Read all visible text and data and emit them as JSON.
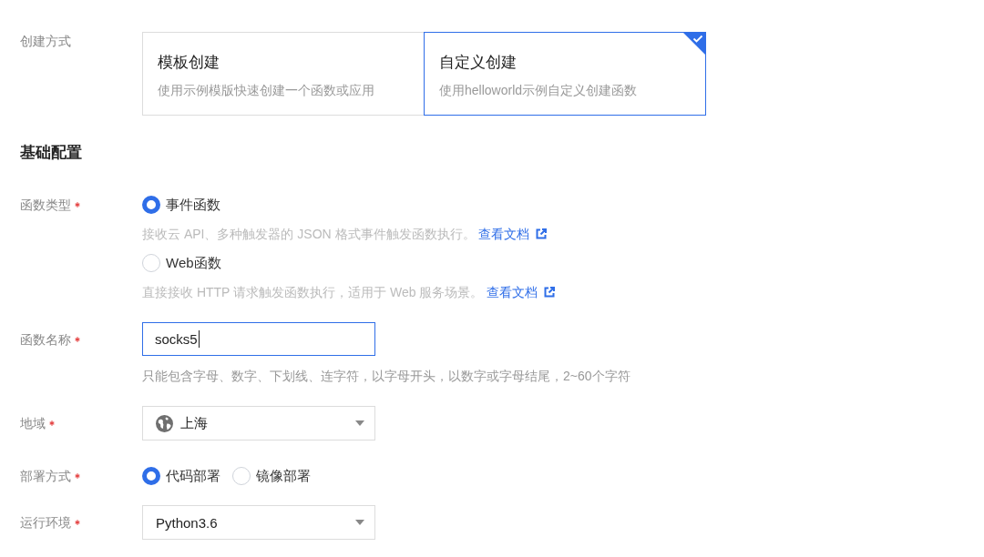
{
  "creation": {
    "label": "创建方式",
    "options": [
      {
        "title": "模板创建",
        "description": "使用示例模版快速创建一个函数或应用",
        "selected": false
      },
      {
        "title": "自定义创建",
        "description": "使用helloworld示例自定义创建函数",
        "selected": true
      }
    ]
  },
  "section_title": "基础配置",
  "fields": [
    {
      "kind": "radiolist",
      "label": "函数类型",
      "required": true,
      "options": [
        {
          "label": "事件函数",
          "selected": true,
          "description": "接收云 API、多种触发器的 JSON 格式事件触发函数执行。",
          "link": "查看文档"
        },
        {
          "label": "Web函数",
          "selected": false,
          "description": "直接接收 HTTP 请求触发函数执行，适用于 Web 服务场景。",
          "link": "查看文档"
        }
      ]
    },
    {
      "kind": "input",
      "label": "函数名称",
      "required": true,
      "value": "socks5",
      "focused": true,
      "hint": "只能包含字母、数字、下划线、连字符，以字母开头，以数字或字母结尾，2~60个字符"
    },
    {
      "kind": "region",
      "label": "地域",
      "required": true,
      "value": "上海"
    },
    {
      "kind": "radiorow",
      "label": "部署方式",
      "required": true,
      "options": [
        {
          "label": "代码部署",
          "selected": true
        },
        {
          "label": "镜像部署",
          "selected": false
        }
      ]
    },
    {
      "kind": "select",
      "label": "运行环境",
      "required": true,
      "value": "Python3.6"
    }
  ]
}
